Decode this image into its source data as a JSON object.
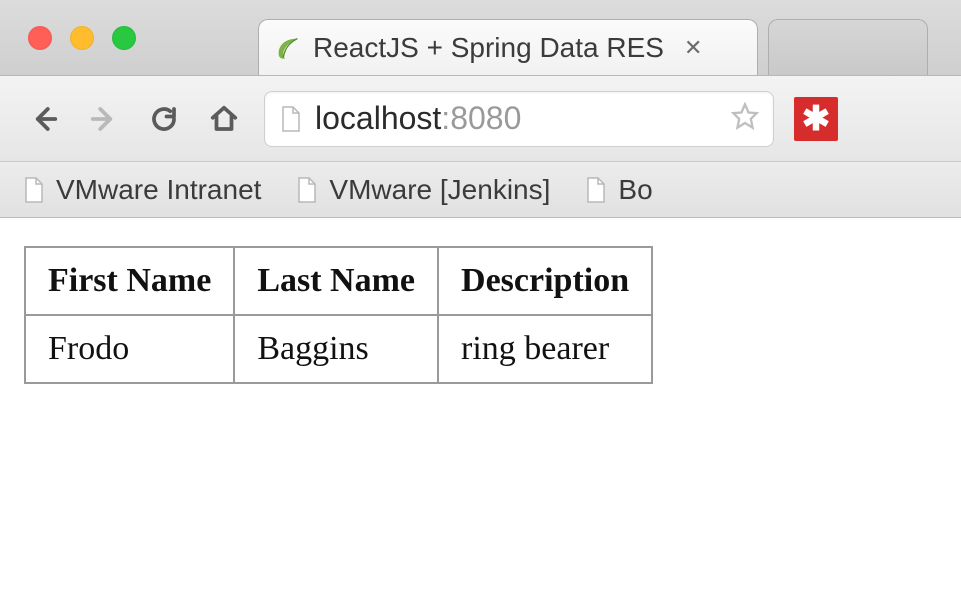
{
  "browser": {
    "tab": {
      "title": "ReactJS + Spring Data RES",
      "favicon_color": "#8bc34a"
    },
    "url": {
      "host": "localhost",
      "port": ":8080"
    },
    "bookmarks": [
      {
        "label": "VMware Intranet"
      },
      {
        "label": "VMware [Jenkins]"
      },
      {
        "label": "Bo"
      }
    ],
    "extension_glyph": "✱"
  },
  "table": {
    "headers": [
      "First Name",
      "Last Name",
      "Description"
    ],
    "rows": [
      [
        "Frodo",
        "Baggins",
        "ring bearer"
      ]
    ]
  }
}
